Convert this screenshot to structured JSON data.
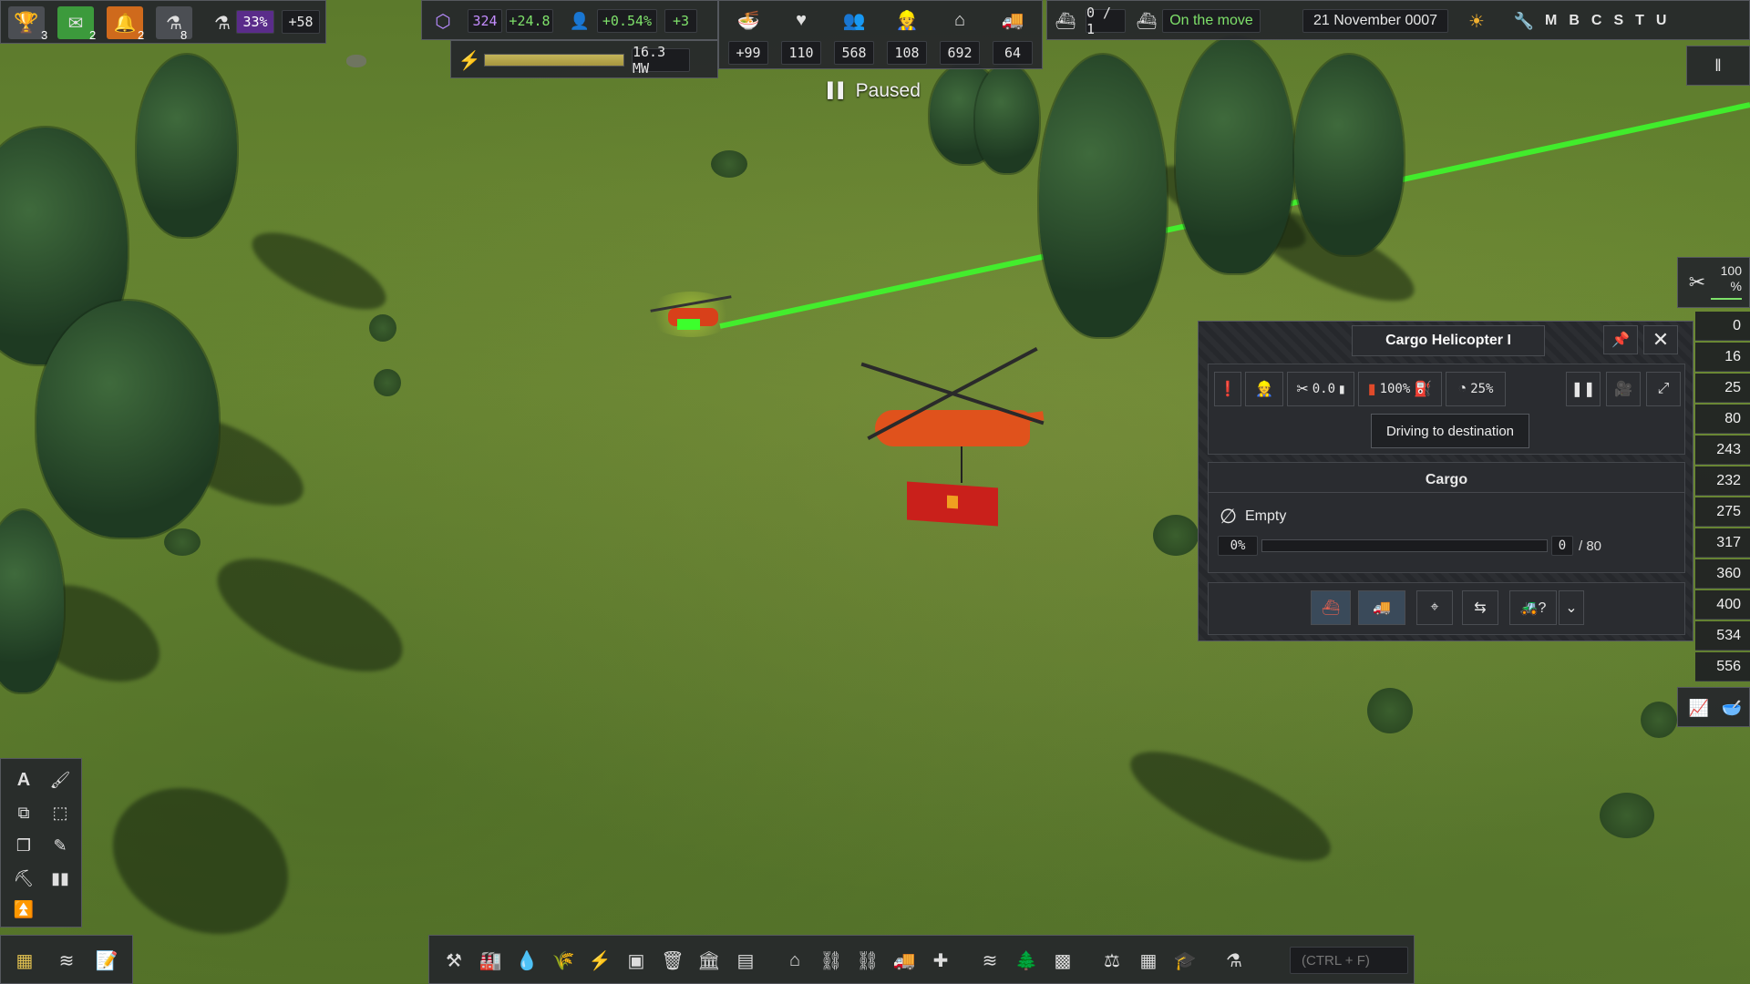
{
  "top_left": {
    "trophy_count": "3",
    "messages_count": "2",
    "alerts_count": "2",
    "research_queue_count": "8",
    "research_progress": "33%",
    "research_rate": "+58"
  },
  "top_center": {
    "unity_value": "324",
    "unity_rate": "+24.8",
    "pop_growth": "+0.54%",
    "pop_rate": "+3",
    "power_value": "16.3 MW",
    "power_fill_fraction": 1.0
  },
  "stats": [
    {
      "icon": "food-icon",
      "value": "+99"
    },
    {
      "icon": "health-icon",
      "value": "110"
    },
    {
      "icon": "population-icon",
      "value": "568"
    },
    {
      "icon": "workers-icon",
      "value": "108"
    },
    {
      "icon": "housing-icon",
      "value": "692"
    },
    {
      "icon": "vehicles-icon",
      "value": "64"
    }
  ],
  "top_right": {
    "ships": "0 / 1",
    "status": "On the move",
    "date": "21 November 0007",
    "menu_letters": [
      "M",
      "B",
      "C",
      "S",
      "T",
      "U"
    ]
  },
  "paused_label": "Paused",
  "right_sidebar": {
    "maintenance_pct": "100\n%",
    "values": [
      "0",
      "16",
      "25",
      "80",
      "243",
      "232",
      "275",
      "317",
      "360",
      "400",
      "534",
      "556"
    ]
  },
  "window": {
    "title": "Cargo Helicopter I",
    "maintenance_value": "0.0",
    "fuel_pct": "100%",
    "speed_pct": "25%",
    "tooltip": "Driving to destination",
    "cargo_title": "Cargo",
    "cargo_state": "Empty",
    "cargo_pct": "0%",
    "cargo_current": "0",
    "cargo_max": "/ 80",
    "cargo_fill_fraction": 0.0
  },
  "search": {
    "placeholder": "(CTRL + F)"
  },
  "colors": {
    "accent_green": "#7ee06a",
    "route_line": "#3cff2c",
    "helicopter": "#e0521c",
    "cargo_box": "#c9201b"
  }
}
